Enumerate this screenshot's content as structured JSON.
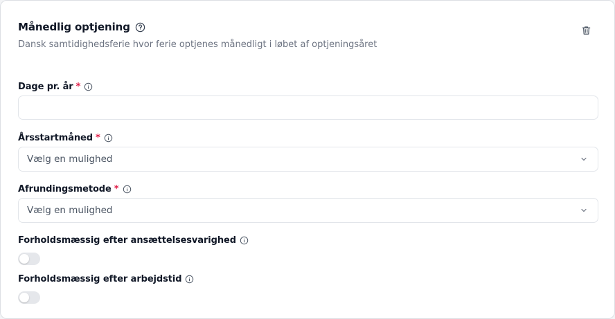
{
  "header": {
    "title": "Månedlig optjening",
    "subtitle": "Dansk samtidighedsferie hvor ferie optjenes månedligt i løbet af optjeningsåret"
  },
  "icons": {
    "help": "question-circle-icon",
    "delete": "trash-icon",
    "info": "info-circle-icon",
    "chevron": "chevron-down-icon"
  },
  "fields": {
    "days_per_year": {
      "label": "Dage pr. år",
      "required_mark": "*",
      "value": ""
    },
    "year_start_month": {
      "label": "Årsstartmåned",
      "required_mark": "*",
      "placeholder": "Vælg en mulighed"
    },
    "rounding_method": {
      "label": "Afrundingsmetode",
      "required_mark": "*",
      "placeholder": "Vælg en mulighed"
    },
    "proportional_employment": {
      "label": "Forholdsmæssig efter ansættelsesvarighed",
      "enabled": false
    },
    "proportional_worktime": {
      "label": "Forholdsmæssig efter arbejdstid",
      "enabled": false
    }
  },
  "colors": {
    "required": "#e11d48",
    "toggle_off": "#e5e7eb",
    "subtitle": "#6b7280"
  }
}
